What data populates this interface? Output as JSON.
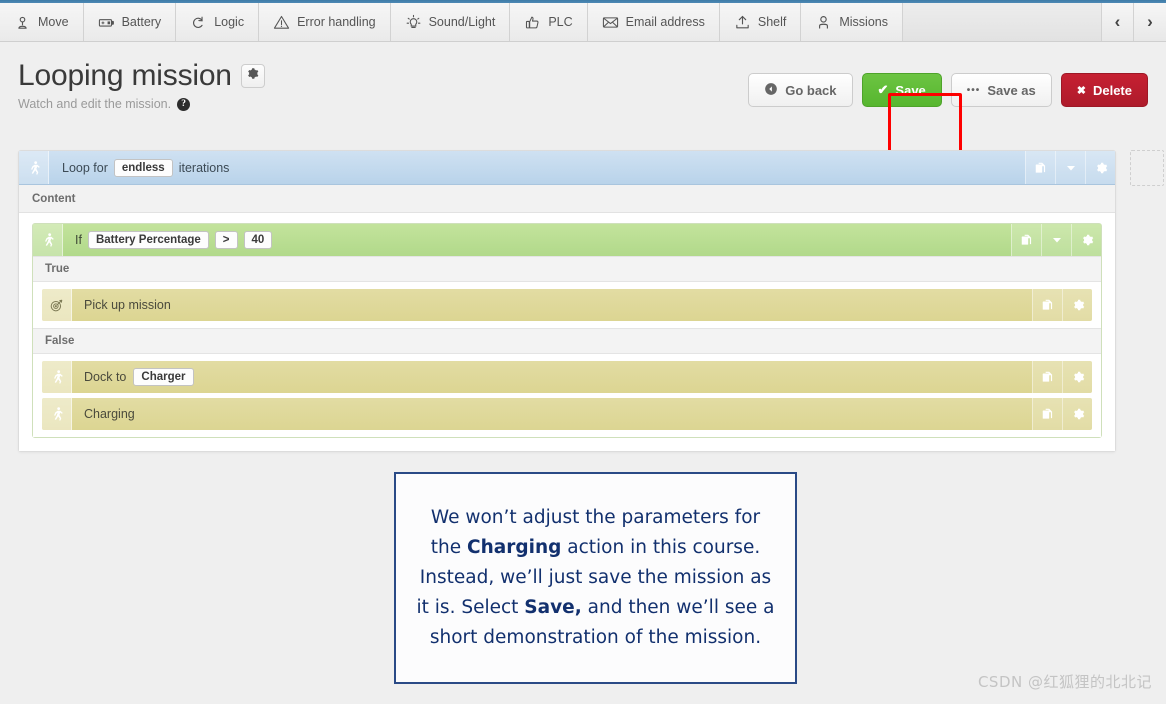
{
  "tabbar": {
    "tabs": [
      {
        "label": "Move",
        "icon": "location-pin-icon"
      },
      {
        "label": "Battery",
        "icon": "battery-icon"
      },
      {
        "label": "Logic",
        "icon": "loop-arrow-icon"
      },
      {
        "label": "Error handling",
        "icon": "warning-triangle-icon"
      },
      {
        "label": "Sound/Light",
        "icon": "lightbulb-icon"
      },
      {
        "label": "PLC",
        "icon": "thumbs-up-icon"
      },
      {
        "label": "Email address",
        "icon": "envelope-icon"
      },
      {
        "label": "Shelf",
        "icon": "upload-shelf-icon"
      },
      {
        "label": "Missions",
        "icon": "person-icon"
      }
    ],
    "prev_arrow": "‹",
    "next_arrow": "›"
  },
  "header": {
    "title": "Looping mission",
    "subtitle": "Watch and edit the mission.",
    "help_glyph": "?",
    "settings_icon": "gear-icon"
  },
  "actions": {
    "go_back": "Go back",
    "save": "Save",
    "save_as": "Save as",
    "delete": "Delete",
    "save_as_glyph": "•••",
    "save_check_glyph": "✔",
    "delete_glyph": "✖",
    "highlight_color": "#fe0000"
  },
  "editor": {
    "loop": {
      "prefix": "Loop for",
      "value": "endless",
      "suffix": "iterations",
      "icon": "running-person-icon",
      "content_label": "Content",
      "buttons": [
        "copy-icon",
        "chevron-down-icon",
        "gear-icon"
      ]
    },
    "condition": {
      "prefix": "If",
      "variable": "Battery Percentage",
      "operator": ">",
      "value": "40",
      "icon": "running-person-icon",
      "buttons": [
        "copy-icon",
        "chevron-down-icon",
        "gear-icon"
      ]
    },
    "branches": [
      {
        "label": "True",
        "items": [
          {
            "label": "Pick up mission",
            "icon": "target-icon",
            "param": null,
            "buttons": [
              "copy-icon",
              "gear-icon"
            ]
          }
        ]
      },
      {
        "label": "False",
        "items": [
          {
            "label": "Dock to",
            "icon": "running-person-icon",
            "param": "Charger",
            "buttons": [
              "copy-icon",
              "gear-icon"
            ]
          },
          {
            "label": "Charging",
            "icon": "running-person-icon",
            "param": null,
            "buttons": [
              "copy-icon",
              "gear-icon"
            ]
          }
        ]
      }
    ]
  },
  "callout": {
    "line1_a": "We won’t adjust the parameters for the ",
    "line1_b": "Charging",
    "line1_c": " action in this course. Instead, we’ll just save the mission as it is. Select ",
    "line1_d": "Save,",
    "line1_e": " and then we’ll see a short demonstration of the mission."
  },
  "watermark": "CSDN @红狐狸的北北记"
}
